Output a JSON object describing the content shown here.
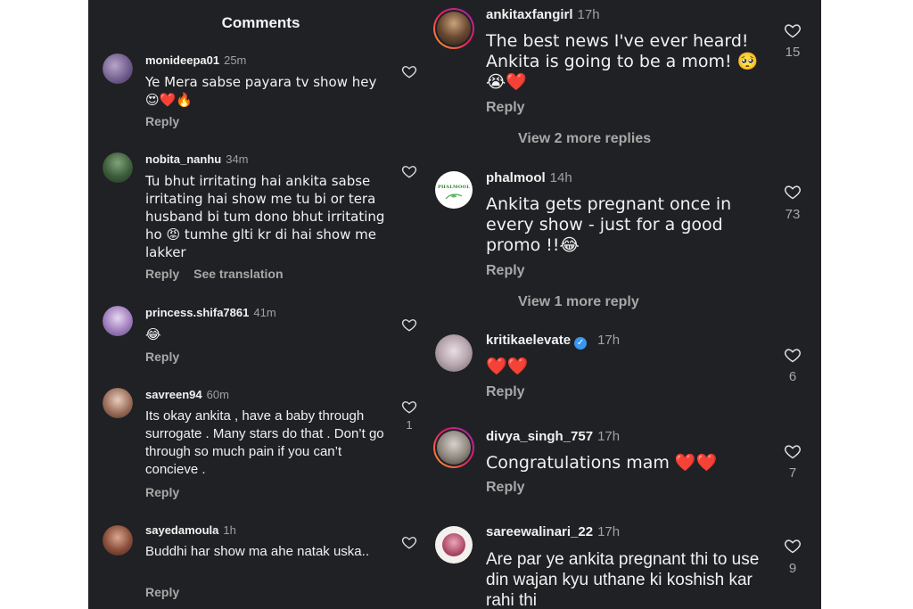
{
  "left": {
    "title": "Comments",
    "comments": [
      {
        "username": "monideepa01",
        "time": "25m",
        "text": "Ye Mera sabse payara tv show hey😍❤️🔥",
        "reply": "Reply"
      },
      {
        "username": "nobita_nanhu",
        "time": "34m",
        "text": "Tu bhut irritating hai ankita sabse irritating hai show me tu bi or tera husband bi tum dono bhut irritating ho 😡 tumhe glti kr di hai show me lakker",
        "reply": "Reply",
        "translate": "See translation"
      },
      {
        "username": "princess.shifa7861",
        "time": "41m",
        "text": "😂",
        "reply": "Reply"
      },
      {
        "username": "savreen94",
        "time": "60m",
        "text": "Its okay ankita , have a baby through surrogate . Many stars do that .  Don’t go through so much pain if you can’t concieve .",
        "reply": "Reply",
        "likes": "1"
      },
      {
        "username": "sayedamoula",
        "time": "1h",
        "text": "Buddhi har show ma ahe natak uska..",
        "reply": "Reply"
      }
    ]
  },
  "right": {
    "comments": [
      {
        "username": "ankitaxfangirl",
        "time": "17h",
        "text": "The best news I've ever heard! Ankita is going to be a mom! 🥺😭❤️",
        "reply": "Reply",
        "likes": "15",
        "more": "View 2 more replies"
      },
      {
        "username": "phalmool",
        "time": "14h",
        "text": "Ankita gets pregnant once in every show - just for a good promo !!😂",
        "reply": "Reply",
        "likes": "73",
        "more": "View 1 more reply",
        "avatar_logo": "PHALMOOL"
      },
      {
        "username": "kritikaelevate",
        "time": "17h",
        "text": "❤️❤️",
        "reply": "Reply",
        "likes": "6",
        "verified": true
      },
      {
        "username": "divya_singh_757",
        "time": "17h",
        "text": "Congratulations mam ❤️❤️",
        "reply": "Reply",
        "likes": "7"
      },
      {
        "username": "sareewalinari_22",
        "time": "17h",
        "text": "Are par ye ankita pregnant thi to use din wajan kyu uthane ki koshish kar rahi thi",
        "likes": "9"
      }
    ]
  },
  "colors": {
    "background": "#202124",
    "text": "#f1f1f1",
    "muted": "#a8a8a8",
    "verified": "#3897f0"
  },
  "icons": {
    "like": "heart-outline-icon",
    "verified": "verified-badge-icon"
  }
}
